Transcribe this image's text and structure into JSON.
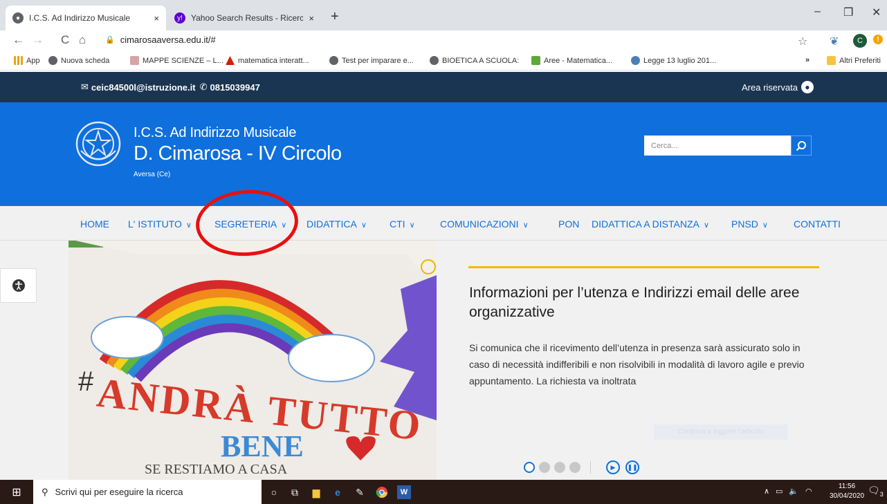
{
  "browser": {
    "tabs": [
      {
        "title": "I.C.S. Ad Indirizzo Musicale",
        "close": "×"
      },
      {
        "title": "Yahoo Search Results - Ricerca ne",
        "close": "×"
      }
    ],
    "new_tab": "+",
    "window_controls": {
      "minimize": "–",
      "restore": "❐",
      "close": "✕"
    },
    "url": "cimarosaaversa.edu.it/#",
    "nav": {
      "back": "←",
      "forward": "→",
      "reload": "C",
      "home": "⌂"
    },
    "star": "☆",
    "profile_initial": "C",
    "alert": "!",
    "bookmarks": [
      {
        "label": "App",
        "color": "#e8a317"
      },
      {
        "label": "Nuova scheda",
        "color": "#5f6368"
      },
      {
        "label": "MAPPE SCIENZE – L...",
        "color": "#d6a5a5"
      },
      {
        "label": "matematica interatt...",
        "color": "#cc2200"
      },
      {
        "label": "Test per imparare e...",
        "color": "#5f6368"
      },
      {
        "label": "BIOETICA A SCUOLA:",
        "color": "#5f6368"
      },
      {
        "label": "Aree - Matematica...",
        "color": "#5fa83a"
      },
      {
        "label": "Legge 13 luglio 201...",
        "color": "#4a7fb5"
      }
    ],
    "bookmarks_more": "»",
    "other_bookmarks": "Altri Preferiti"
  },
  "site": {
    "topbar": {
      "email": "ceic84500l@istruzione.it",
      "phone": "0815039947",
      "reserved_area": "Area riservata"
    },
    "header": {
      "line1": "I.C.S. Ad Indirizzo Musicale",
      "line2": "D. Cimarosa - IV Circolo",
      "city": "Aversa (Ce)",
      "search_placeholder": "Cerca..."
    },
    "nav": [
      {
        "label": "HOME",
        "dropdown": false
      },
      {
        "label": "L' ISTITUTO",
        "dropdown": true
      },
      {
        "label": "SEGRETERIA",
        "dropdown": true
      },
      {
        "label": "DIDATTICA",
        "dropdown": true
      },
      {
        "label": "CTI",
        "dropdown": true
      },
      {
        "label": "COMUNICAZIONI",
        "dropdown": true
      },
      {
        "label": "PON",
        "dropdown": false
      },
      {
        "label": "DIDATTICA A DISTANZA",
        "dropdown": true
      },
      {
        "label": "PNSD",
        "dropdown": true
      },
      {
        "label": "CONTATTI",
        "dropdown": false
      }
    ],
    "hero_image_text": {
      "hashtag": "#",
      "line1": "ANDRÀ TUTTO",
      "line2": "BENE",
      "line3": "SE RESTIAMO A CASA"
    },
    "news": {
      "title": "Informazioni per l’utenza e Indirizzi email delle aree organizzative",
      "body": "Si comunica che il ricevimento dell’utenza in presenza sarà assicurato solo in caso di necessità indifferibili e non risolvibili in modalità di lavoro agile e previo appuntamento. La richiesta va inoltrata",
      "read_more": "Continua a leggere l’articolo"
    },
    "carousel": {
      "slides": 4,
      "active": 1
    }
  },
  "taskbar": {
    "search_placeholder": "Scrivi qui per eseguire la ricerca",
    "time": "11:56",
    "date": "30/04/2020",
    "notifications": "3"
  },
  "colors": {
    "site_topbar": "#1a3551",
    "header_blue": "#0f6fdd",
    "accent_yellow": "#f5b800",
    "highlight_red": "#e81010"
  }
}
